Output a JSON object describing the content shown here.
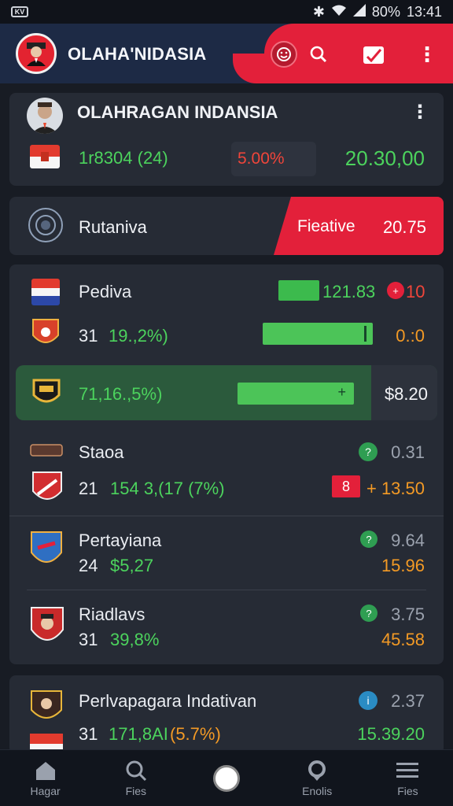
{
  "status_bar": {
    "left_badge": "KV",
    "battery": "80%",
    "time": "13:41"
  },
  "app_bar": {
    "title": "OLAHA'NIDASIA",
    "icons": [
      "profile-icon",
      "search-icon",
      "calendar-icon",
      "more-icon"
    ]
  },
  "featured": {
    "title": "OLAHRAGAN INDANSIA",
    "stat_left": "1r8304 (24)",
    "stat_mid": "5.00%",
    "stat_right": "20.30,00"
  },
  "highlight": {
    "label": "Rutaniva",
    "badge_label": "Fieative",
    "badge_value": "20.75"
  },
  "list": [
    {
      "name": "Pediva",
      "right_value": "121.83",
      "count": "10",
      "sub_left": "31",
      "sub_value": "19.,2%)",
      "sub_right": "0.:0"
    },
    {
      "name": "71,16.,5%)",
      "right_value": "$8.20"
    },
    {
      "name": "Staoa",
      "right_value": "0.31",
      "sub_left": "21",
      "sub_value": "154 3,(17 (7%)",
      "sub_right": "+ 13.50",
      "chip": "8"
    },
    {
      "name": "Pertayiana",
      "right_value": "9.64",
      "sub_left": "24",
      "sub_value": "$5,27",
      "sub_right": "15.96"
    },
    {
      "name": "Riadlavs",
      "right_value": "3.75",
      "sub_left": "31",
      "sub_value": "39,8%",
      "sub_right": "45.58"
    }
  ],
  "bottom_card": {
    "title": "Perlvapagara Indativan",
    "right_value": "2.37",
    "sub_left": "31",
    "sub_value": "171,8AI",
    "sub_pct": "(5.7%)",
    "sub_right": "15.39.20"
  },
  "bottom_nav": [
    {
      "label": "Hagar",
      "icon": "home-icon"
    },
    {
      "label": "Fies",
      "icon": "search-icon"
    },
    {
      "label": "",
      "icon": "circle-icon"
    },
    {
      "label": "Enolis",
      "icon": "pin-icon"
    },
    {
      "label": "Fies",
      "icon": "menu-icon"
    }
  ],
  "colors": {
    "appbar_blue": "#1d2a45",
    "accent_red": "#e3203a",
    "green": "#4cd35d",
    "orange": "#f39a25",
    "card_bg": "#262b35"
  }
}
